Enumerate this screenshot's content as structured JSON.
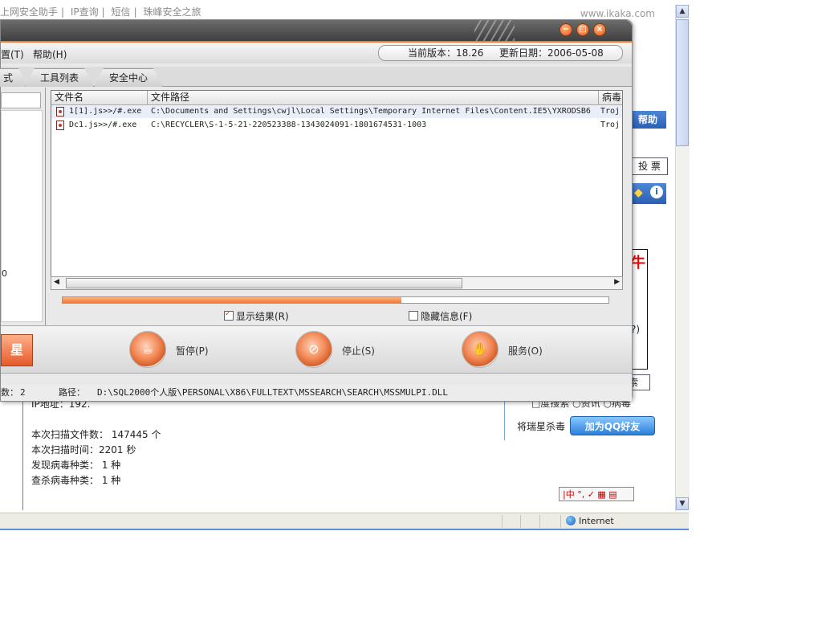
{
  "browser": {
    "topbar_links": [
      "上网安全助手",
      "IP查询",
      "短信",
      "珠峰安全之旅"
    ],
    "site_url": "www.ikaka.com",
    "status_zone": "Internet",
    "scan_summary": {
      "ip_line": "IP地址：192.",
      "files_scanned": "本次扫描文件数： 147445 个",
      "scan_time": "本次扫描时间：2201 秒",
      "virus_found": "发现病毒种类： 1 种",
      "virus_killed": "查杀病毒种类： 1 种"
    },
    "right_panel": {
      "help": "帮助",
      "vote": "投 票",
      "red_char": "牛",
      "paren": "?)",
      "search": "索",
      "radio_line": "□度搜索 ○资讯 ○病毒",
      "rising_label": "将瑞星杀毒",
      "qq_button": "加为QQ好友",
      "ime_bar": "|中 °, ✓ ▦ ▤"
    }
  },
  "app": {
    "window_buttons": [
      "−",
      "□",
      "×"
    ],
    "menu": {
      "settings": "置(T)",
      "help": "帮助(H)"
    },
    "version": {
      "current": "当前版本：18.26",
      "update_date": "更新日期：2006-05-08"
    },
    "tabs": [
      "式",
      "工具列表",
      "安全中心"
    ],
    "left_pane_digit": "0",
    "file_list": {
      "columns": [
        "文件名",
        "文件路径",
        "病毒"
      ],
      "rows": [
        {
          "name": "1[1].js>>/#.exe",
          "path": "C:\\Documents and Settings\\cwjl\\Local Settings\\Temporary Internet Files\\Content.IE5\\YXRODSB6",
          "virus": "Troj"
        },
        {
          "name": "Dc1.js>>/#.exe",
          "path": "C:\\RECYCLER\\S-1-5-21-220523388-1343024091-1801674531-1003",
          "virus": "Troj"
        }
      ]
    },
    "progress": {
      "value": 0.62
    },
    "options": {
      "show_results": "显示结果(R)",
      "hide_info": "隐藏信息(F)"
    },
    "buttons": {
      "star": "星",
      "pause": "暂停(P)",
      "stop": "停止(S)",
      "service": "服务(O)"
    },
    "status": {
      "count_label": "数：",
      "count": "2",
      "path_label": "路径：",
      "path": "D:\\SQL2000个人版\\PERSONAL\\X86\\FULLTEXT\\MSSEARCH\\SEARCH\\MSSMULPI.DLL"
    }
  }
}
